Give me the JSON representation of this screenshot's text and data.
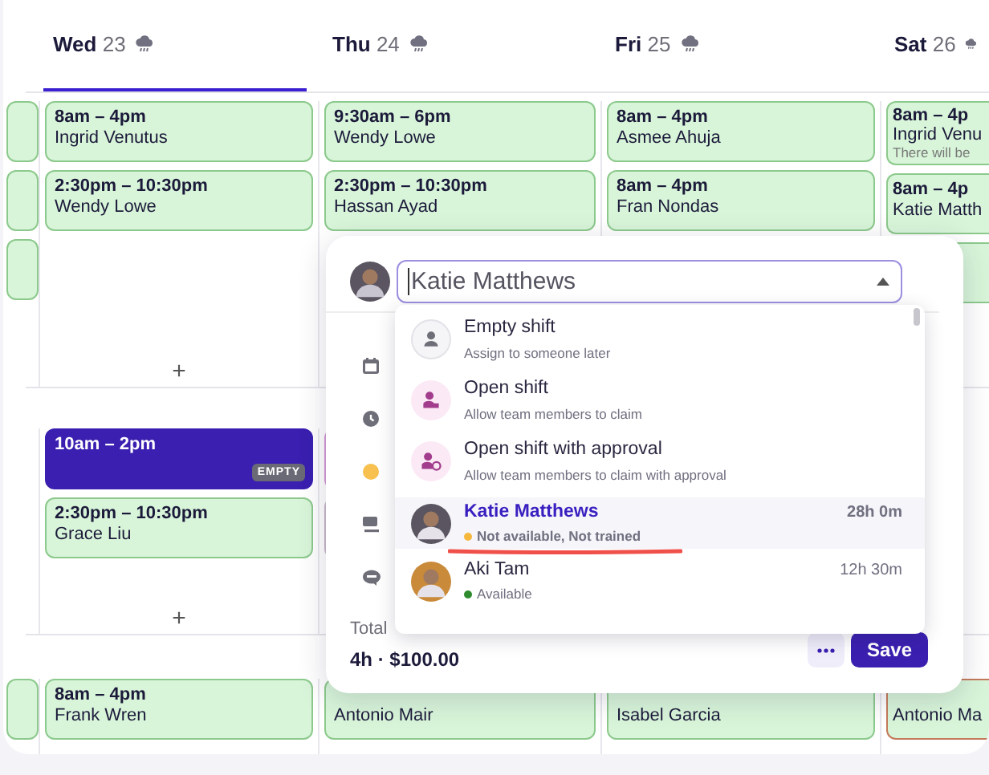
{
  "days": [
    {
      "day": "Wed",
      "date": "23",
      "selected": true
    },
    {
      "day": "Thu",
      "date": "24",
      "selected": false
    },
    {
      "day": "Fri",
      "date": "25",
      "selected": false
    },
    {
      "day": "Sat",
      "date": "26",
      "selected": false
    }
  ],
  "sections": [
    {
      "columns": [
        {
          "cards": [
            {
              "kind": "shift",
              "color": "#8cc98c"
            },
            {
              "kind": "shift",
              "color": "#8cc98c"
            },
            {
              "kind": "shift",
              "color": "#8cc98c"
            }
          ]
        },
        {
          "cards": [
            {
              "kind": "shift",
              "color": "#8cc98c",
              "time": "8am – 4pm",
              "name": "Ingrid Venutus"
            },
            {
              "kind": "shift",
              "color": "#8cc98c",
              "time": "2:30pm – 10:30pm",
              "name": "Wendy Lowe"
            }
          ],
          "add": "+"
        },
        {
          "cards": [
            {
              "kind": "shift",
              "color": "#8cc98c",
              "time": "9:30am – 6pm",
              "name": "Wendy Lowe"
            },
            {
              "kind": "shift",
              "color": "#8cc98c",
              "time": "2:30pm – 10:30pm",
              "name": "Hassan Ayad"
            }
          ]
        },
        {
          "cards": [
            {
              "kind": "shift",
              "color": "#8cc98c",
              "time": "8am – 4pm",
              "name": "Asmee Ahuja"
            },
            {
              "kind": "shift",
              "color": "#8cc98c",
              "time": "8am – 4pm",
              "name": "Fran Nondas"
            }
          ]
        },
        {
          "cards": [
            {
              "kind": "shift",
              "color": "#8cc98c",
              "time": "8am – 4p",
              "name": "Ingrid Venu",
              "note": "There will be"
            },
            {
              "kind": "shift",
              "color": "#8cc98c",
              "time": "8am – 4p",
              "name": "Katie Matth"
            },
            {
              "kind": "shift",
              "color": "#8cc98c"
            }
          ]
        }
      ]
    },
    {
      "columns": [
        {},
        {
          "cards": [
            {
              "kind": "empty",
              "color": "#3a1fb0",
              "time": "10am – 2pm",
              "badge": "EMPTY"
            },
            {
              "kind": "shift",
              "color": "#8cc98c",
              "time": "2:30pm – 10:30pm",
              "name": "Grace Liu"
            }
          ],
          "add": "+"
        },
        {
          "cards": [
            {
              "kind": "open",
              "color": "#d59ad5"
            },
            {
              "kind": "shift",
              "color": "#c9b8c9"
            }
          ]
        },
        {},
        {}
      ]
    },
    {
      "columns": [
        {
          "cards": [
            {
              "kind": "shift",
              "color": "#8cc98c"
            }
          ]
        },
        {
          "cards": [
            {
              "kind": "shift",
              "color": "#8cc98c",
              "time": "8am – 4pm",
              "name": "Frank Wren"
            }
          ]
        },
        {
          "cards": [
            {
              "kind": "shift",
              "color": "#8cc98c",
              "name": "Antonio Mair"
            }
          ]
        },
        {
          "cards": [
            {
              "kind": "shift",
              "color": "#8cc98c",
              "name": "Isabel Garcia"
            }
          ]
        },
        {
          "cards": [
            {
              "kind": "shift",
              "color": "#c47a5a",
              "name": "Antonio Ma"
            }
          ]
        }
      ]
    }
  ],
  "popover": {
    "assignee": {
      "value": "Katie Matthews"
    },
    "total": {
      "label": "Total",
      "value": "4h · $100.00"
    },
    "save_button": "Save"
  },
  "dropdown": {
    "options": [
      {
        "kind": "empty",
        "title": "Empty shift",
        "subtitle": "Assign to someone later"
      },
      {
        "kind": "open",
        "title": "Open shift",
        "subtitle": "Allow team members to claim"
      },
      {
        "kind": "approval",
        "title": "Open shift with approval",
        "subtitle": "Allow team members to claim with approval"
      }
    ],
    "members": [
      {
        "name": "Katie Matthews",
        "hours": "28h 0m",
        "status": "Not available, Not trained",
        "color": "#f5b83d",
        "selected": true
      },
      {
        "name": "Aki Tam",
        "hours": "12h 30m",
        "status": "Available",
        "color": "#2e8b2e",
        "selected": false
      }
    ]
  }
}
